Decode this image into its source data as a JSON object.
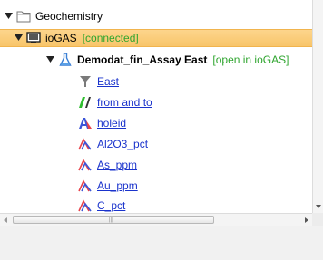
{
  "tree": {
    "root": {
      "label": "Geochemistry"
    },
    "connection": {
      "label": "ioGAS",
      "status": "[connected]"
    },
    "dataset": {
      "label": "Demodat_fin_Assay East",
      "status": "[open in ioGAS]"
    },
    "fields": [
      {
        "label": "East",
        "icon": "funnel-icon"
      },
      {
        "label": "from and to",
        "icon": "interval-icon"
      },
      {
        "label": "holeid",
        "icon": "text-field-icon"
      },
      {
        "label": "Al2O3_pct",
        "icon": "numeric-field-icon"
      },
      {
        "label": "As_ppm",
        "icon": "numeric-field-icon"
      },
      {
        "label": "Au_ppm",
        "icon": "numeric-field-icon"
      },
      {
        "label": "C_pct",
        "icon": "numeric-field-icon"
      }
    ]
  },
  "colors": {
    "selection": "#f8c56a",
    "status_green": "#2fa52f",
    "link_blue": "#1a33cc"
  }
}
